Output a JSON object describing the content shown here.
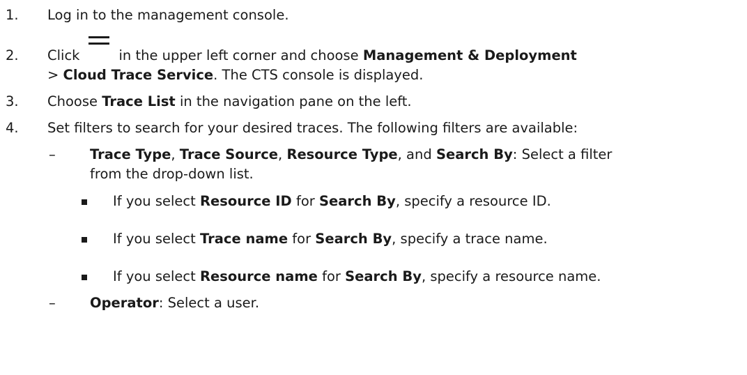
{
  "steps": [
    {
      "num": "1.",
      "text": "Log in to the management console."
    },
    {
      "num": "2.",
      "before": "Click",
      "icon": "menu-icon",
      "after": "in the upper left corner and choose",
      "b1": "Management & Deployment",
      "line2_pre": ">",
      "b2": "Cloud Trace Service",
      "line2_post": ". The CTS console is displayed."
    },
    {
      "num": "3.",
      "pre": "Choose",
      "b1": "Trace List",
      "post": "in the navigation pane on the left."
    },
    {
      "num": "4.",
      "text": "Set filters to search for your desired traces. The following filters are available:"
    }
  ],
  "filters": {
    "dash": "–",
    "f1": "Trace Type",
    "sep1": ",",
    "f2": "Trace Source",
    "sep2": ",",
    "f3": "Resource Type",
    "sep3": ", and",
    "f4": "Search By",
    "desc1": ": Select a filter",
    "desc2": "from the drop-down list.",
    "options": [
      {
        "pre": "If you select",
        "b1": "Resource ID",
        "mid": "for",
        "b2": "Search By",
        "post": ", specify a resource ID."
      },
      {
        "pre": "If you select",
        "b1": "Trace name",
        "mid": "for",
        "b2": "Search By",
        "post": ", specify a trace name."
      },
      {
        "pre": "If you select",
        "b1": "Resource name",
        "mid": "for",
        "b2": "Search By",
        "post": ", specify a resource name."
      }
    ],
    "operator": "Operator",
    "operator_desc": ": Select a user."
  }
}
